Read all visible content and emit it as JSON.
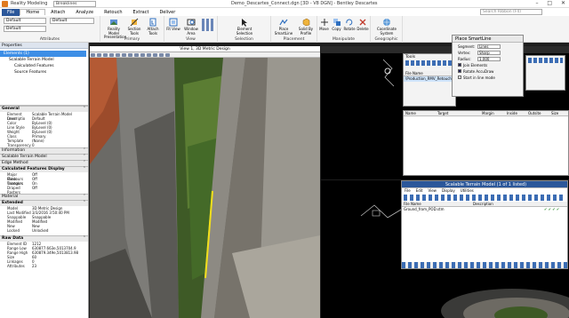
{
  "titlebar": {
    "app_name": "Reality Modeling",
    "doc_title": "Demo_Descartes_Connect.dgn [3D - V8 DGN] - Bentley Descartes",
    "quick_access_combo": "Breaklines",
    "minimize": "–",
    "maximize": "□",
    "close": "✕"
  },
  "menu": {
    "file": "File",
    "items": [
      "Home",
      "Attach",
      "Analyze",
      "Retouch",
      "Extract",
      "Deliver"
    ],
    "active": "Home",
    "search_placeholder": "Search Ribbon (F4)"
  },
  "ribbon": {
    "combos": [
      "Default",
      "Default",
      "Default"
    ],
    "groups": [
      {
        "label": "Attributes"
      },
      {
        "label": "Primary"
      },
      {
        "label": "View"
      },
      {
        "label": "Selection"
      },
      {
        "label": "Placement"
      },
      {
        "label": "Manipulate"
      },
      {
        "label": "Geographic"
      }
    ],
    "buttons": [
      {
        "label": "Reality Model Presentation",
        "icon": "reality-model-icon"
      },
      {
        "label": "Section Tools",
        "icon": "section-tools-icon"
      },
      {
        "label": "Attach Tools",
        "icon": "attach-tools-icon"
      },
      {
        "label": "Fit View",
        "icon": "fit-view-icon"
      },
      {
        "label": "Window Area",
        "icon": "window-area-icon"
      },
      {
        "label": "Element Selection",
        "icon": "element-selection-icon"
      },
      {
        "label": "Place SmartLine",
        "icon": "smartline-icon"
      },
      {
        "label": "Solid By Profile",
        "icon": "solid-profile-icon"
      },
      {
        "label": "Move",
        "icon": "move-icon"
      },
      {
        "label": "Copy",
        "icon": "copy-icon"
      },
      {
        "label": "Rotate",
        "icon": "rotate-icon"
      },
      {
        "label": "Delete",
        "icon": "delete-icon"
      },
      {
        "label": "Coordinate System",
        "icon": "globe-icon"
      }
    ]
  },
  "properties": {
    "title": "Properties",
    "tree": [
      {
        "label": "Elements (1)",
        "selected": true
      },
      {
        "label": "Scalable Terrain Model",
        "selected": false
      },
      {
        "label": "Calculated Features",
        "selected": false
      },
      {
        "label": "Source Features",
        "selected": false
      }
    ],
    "sections": {
      "general": "General",
      "information": "Information",
      "stm": "Scalable Terrain Model",
      "edge": "Edge Method",
      "calc": "Calculated Features Display",
      "material": "Material",
      "extended": "Extended",
      "rawdata": "Raw Data"
    },
    "general_rows": [
      [
        "Element Descriptio",
        "Scalable Terrain Model"
      ],
      [
        "Level",
        "Default"
      ],
      [
        "Color",
        "ByLevel (0)"
      ],
      [
        "Line Style",
        "ByLevel (0)"
      ],
      [
        "Weight",
        "ByLevel (0)"
      ],
      [
        "Class",
        "Primary"
      ],
      [
        "Template",
        "(None)"
      ],
      [
        "Transparency",
        "0"
      ]
    ],
    "calc_rows": [
      [
        "Major Contours",
        "Off"
      ],
      [
        "Minor Contours",
        "Off"
      ],
      [
        "Triangles",
        "On"
      ],
      [
        "Draped Rasters",
        "Off"
      ]
    ],
    "extended_rows": [
      [
        "Model",
        "3D Metric Design"
      ],
      [
        "Last Modified",
        "3/3/2016 3:50:40 PM"
      ],
      [
        "Snappable",
        "Snappable"
      ],
      [
        "Modified",
        "Modified"
      ],
      [
        "New",
        "New"
      ],
      [
        "Locked",
        "Unlocked"
      ]
    ],
    "raw_rows": [
      [
        "Element ID",
        "1212"
      ],
      [
        "Range Low",
        "630877.663e,5013704.9"
      ],
      [
        "Range High",
        "630879.349e,5013813.98"
      ],
      [
        "Size",
        "60"
      ],
      [
        "Linkages",
        "0"
      ],
      [
        "Attributes",
        "23"
      ]
    ]
  },
  "view1": {
    "title": "View 1, 3D Metric Design"
  },
  "image_dialog": {
    "tools_label": "Tools",
    "col_file": "File Name",
    "row_file": "\\Production_RMV_Retouched"
  },
  "smartline": {
    "title": "Place SmartLine",
    "segments_label": "Segment:",
    "segments_value": "Lines",
    "vertex_label": "Vertex:",
    "vertex_value": "Sharp",
    "radius_label": "Radius:",
    "radius_value": "1.000",
    "checks": [
      {
        "label": "Join Elements",
        "on": true
      },
      {
        "label": "Rotate AccuDraw",
        "on": true
      },
      {
        "label": "Start in line mode",
        "on": false
      }
    ]
  },
  "mesh_table": {
    "cols": [
      "Name",
      "Target",
      "Margin",
      "Inside",
      "Outsite",
      "Size"
    ]
  },
  "stm_dialog": {
    "title": "Scalable Terrain Model (1 of 1 listed)",
    "menu": [
      "File",
      "Edit",
      "View",
      "Display",
      "Utilities"
    ],
    "cols": [
      "File Name",
      "Description"
    ],
    "row_file": "Ground_from_POD.stm",
    "row_desc": ""
  }
}
